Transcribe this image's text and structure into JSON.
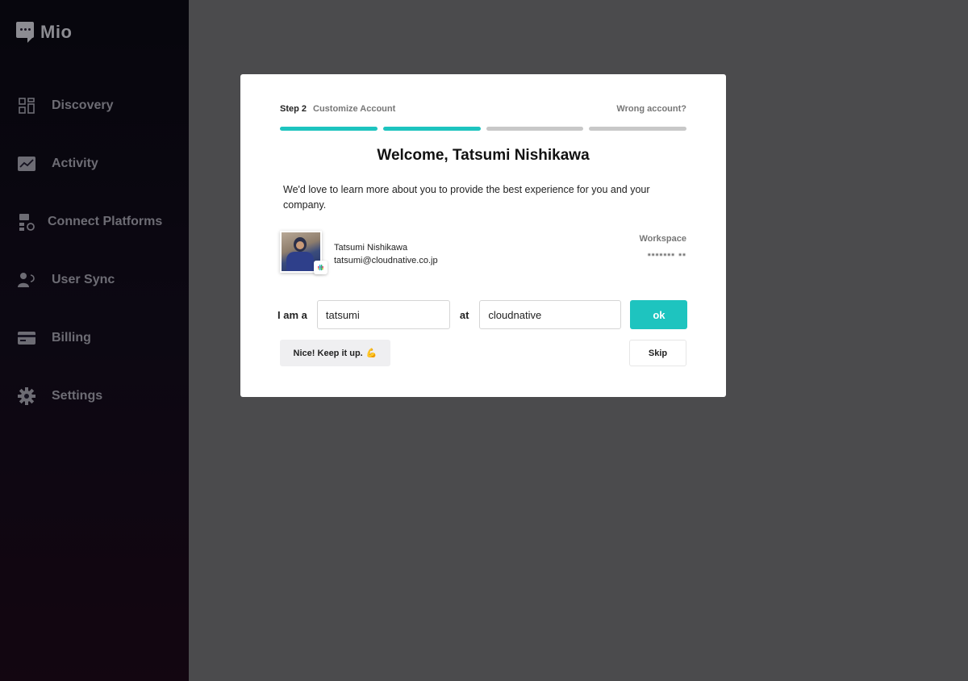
{
  "app": {
    "name": "Mio"
  },
  "sidebar": {
    "items": [
      {
        "label": "Discovery",
        "icon": "grid-icon"
      },
      {
        "label": "Activity",
        "icon": "chart-icon"
      },
      {
        "label": "Connect Platforms",
        "icon": "platforms-icon"
      },
      {
        "label": "User Sync",
        "icon": "user-sync-icon"
      },
      {
        "label": "Billing",
        "icon": "credit-card-icon"
      },
      {
        "label": "Settings",
        "icon": "gear-icon"
      }
    ]
  },
  "modal": {
    "step_number": "Step 2",
    "step_name": "Customize Account",
    "wrong_account": "Wrong account?",
    "progress": {
      "total": 4,
      "completed": 2
    },
    "title": "Welcome, Tatsumi Nishikawa",
    "description": "We'd love to learn more about you to provide the best experience for you and your company.",
    "user": {
      "name": "Tatsumi Nishikawa",
      "email": "tatsumi@cloudnative.co.jp"
    },
    "workspace_label": "Workspace",
    "workspace_value": "▪▪▪▪▪▪▪ ▪▪",
    "form": {
      "role_label": "I am a",
      "role_value": "tatsumi",
      "company_label": "at",
      "company_value": "cloudnative",
      "ok_label": "ok",
      "encouragement": "Nice! Keep it up.",
      "encouragement_emoji": "💪",
      "skip_label": "Skip"
    }
  },
  "colors": {
    "accent": "#1ec4bf",
    "overlay": "#4b4b4d"
  }
}
